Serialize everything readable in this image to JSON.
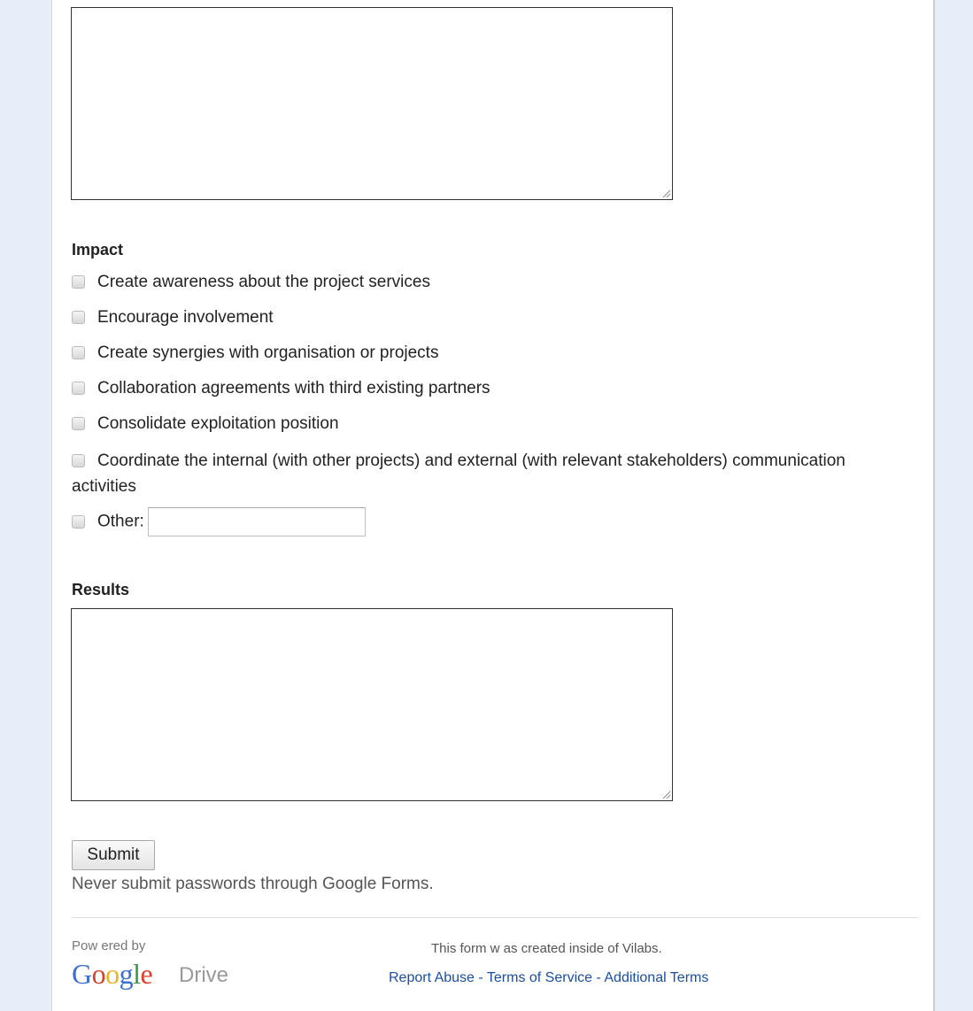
{
  "impact": {
    "title": "Impact",
    "options": [
      "Create awareness about the project services",
      "Encourage involvement",
      "Create synergies with organisation or projects",
      "Collaboration agreements with third existing partners",
      "Consolidate exploitation position",
      "Coordinate the internal (with other projects) and external (with relevant stakeholders) communication activities"
    ],
    "other_label": "Other:"
  },
  "results": {
    "title": "Results"
  },
  "submit": {
    "label": "Submit",
    "note": "Never submit passwords through Google Forms."
  },
  "footer": {
    "powered_by": "Pow ered by",
    "logo_text": "Google",
    "logo_product": "Drive",
    "created_inside": "This form w as created inside of Vilabs.",
    "links": [
      "Report Abuse",
      "Terms of Service",
      "Additional Terms"
    ],
    "separator": " - "
  },
  "colors": {
    "page_bg": "#e8eef9",
    "link": "#1a4fa0"
  }
}
